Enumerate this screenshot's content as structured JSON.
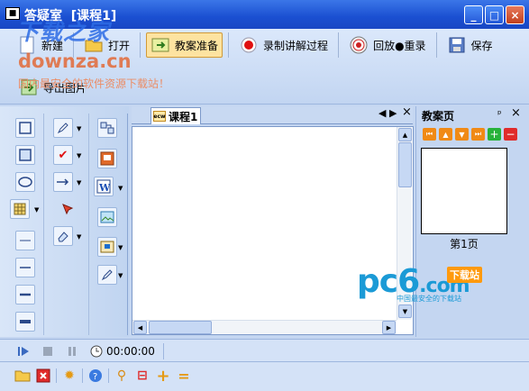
{
  "window": {
    "app_name": "答疑室",
    "doc_title": "[课程1]",
    "minimize": "_",
    "maximize": "□",
    "close": "×"
  },
  "toolbar": {
    "new_label": "新建",
    "open_label": "打开",
    "prepare_label": "教案准备",
    "record_label": "录制讲解过程",
    "replay_label": "回放●重录",
    "save_label": "保存",
    "export_label": "导出图片"
  },
  "watermark": {
    "logo": "下载之家",
    "url": "downza.cn",
    "slogan": "国内最安全的软件资源下载站！"
  },
  "document": {
    "tab_label": "课程1",
    "tab_icon_text": "ecw",
    "prev": "◀",
    "next": "▶",
    "close": "×"
  },
  "lesson_panel": {
    "title": "教案页",
    "pin": "ᵖ",
    "close": "×",
    "page_label": "第1页"
  },
  "pc6": {
    "logo": "pc6",
    "com": ".com",
    "badge": "下载站",
    "sub": "中国最安全的下载站"
  },
  "timeline": {
    "time": "00:00:00"
  },
  "colors": {
    "accent": "#1a4fd1",
    "record_red": "#e01010",
    "nav_orange": "#f08a16",
    "nav_green": "#27b23a",
    "nav_red": "#e02b2b"
  }
}
